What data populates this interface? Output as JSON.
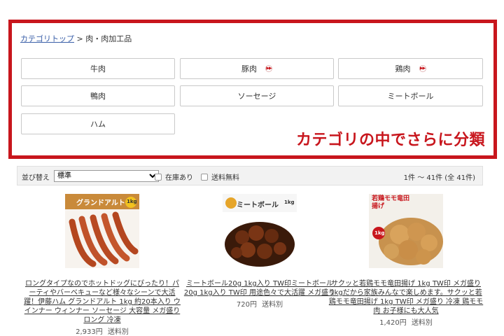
{
  "breadcrumb": {
    "top_label": "カテゴリトップ",
    "separator": ">",
    "current": "肉・肉加工品"
  },
  "categories": [
    {
      "label": "牛肉",
      "has_more": false
    },
    {
      "label": "豚肉",
      "has_more": true
    },
    {
      "label": "鶏肉",
      "has_more": true
    },
    {
      "label": "鴨肉",
      "has_more": false
    },
    {
      "label": "ソーセージ",
      "has_more": false
    },
    {
      "label": "ミートボール",
      "has_more": false
    },
    {
      "label": "ハム",
      "has_more": false
    }
  ],
  "more_icon_glyph": "▶▶",
  "callout_text": "カテゴリの中でさらに分類",
  "toolbar": {
    "sort_label": "並び替え",
    "sort_selected": "標準",
    "in_stock_label": "在庫あり",
    "free_shipping_label": "送料無料",
    "result_count": "1件 〜 41件 (全 41件)"
  },
  "products": [
    {
      "title": "ロングタイプなのでホットドッグにぴったり！パーティやバーベキューなど様々なシーンで大活躍！伊藤ハム グランドアルト 1kg 約20本入り ウインナー ウィンナー ソーセージ 大容量 メガ盛り ロング 冷凍",
      "price": "2,933円",
      "shipping": "送料別",
      "image_label": "グランドアルト",
      "image_badge": "1kg"
    },
    {
      "title": "ミートボール20g 1kg入り TW印ミートボール20g 1kg入り TW印 用途色々で大活躍 メガ盛り",
      "price": "720円",
      "shipping": "送料別",
      "image_label": "ミートボール",
      "image_badge": "1kg"
    },
    {
      "title": "サクッと若鶏モモ竜田揚げ 1kg TW印 メガ盛り1kgだから家族みんなで楽しめます。サクッと若鶏モモ竜田揚げ 1kg TW印 メガ盛り 冷凍 鶏モモ肉 お子様にも大人気",
      "price": "1,420円",
      "shipping": "送料別",
      "image_label": "若鶏モモ竜田揚げ",
      "image_badge": "1kg"
    }
  ],
  "colors": {
    "accent_red": "#c8161d",
    "link_blue": "#3a5fa8"
  }
}
